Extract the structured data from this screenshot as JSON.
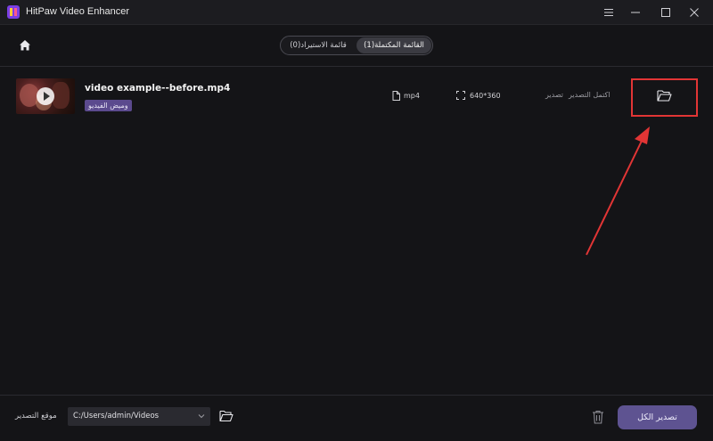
{
  "window": {
    "title": "HitPaw Video Enhancer"
  },
  "tabs": [
    {
      "label": "القائمة المكتملة(1)",
      "active": true
    },
    {
      "label": "قائمة الاستيراد(0)",
      "active": false
    }
  ],
  "row": {
    "filename": "video example--before.mp4",
    "badge": "وميض الفيديو",
    "format": "mp4",
    "resolution": "640*360",
    "status_completed": "اكتمل التصدير",
    "status_export": "تصدير"
  },
  "bottom": {
    "export_location_label": "موقع التصدير",
    "path_value": "C:/Users/admin/Videos",
    "export_all_label": "تصدير الكل"
  },
  "colors": {
    "accent": "#5e5391",
    "badge": "#5b4a8e",
    "highlight": "#e23535"
  }
}
